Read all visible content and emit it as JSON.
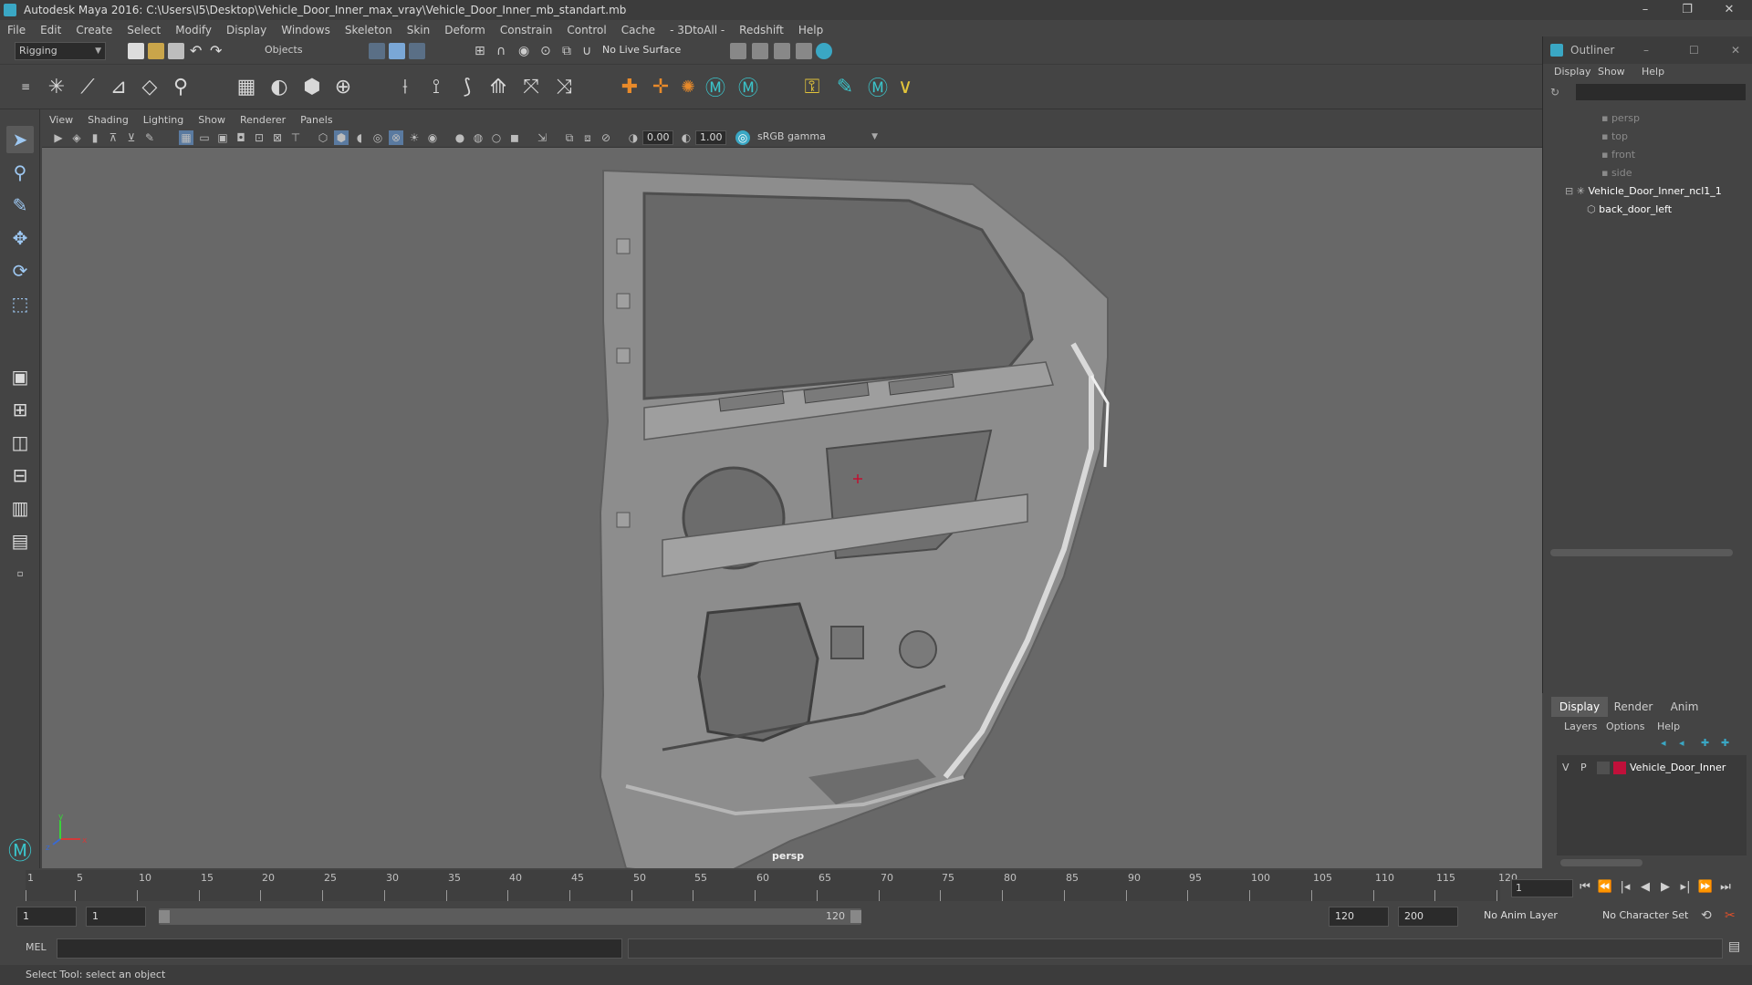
{
  "window": {
    "title": "Autodesk Maya 2016: C:\\Users\\I5\\Desktop\\Vehicle_Door_Inner_max_vray\\Vehicle_Door_Inner_mb_standart.mb",
    "minimize": "–",
    "restore": "❐",
    "close": "✕"
  },
  "menu": [
    "File",
    "Edit",
    "Create",
    "Select",
    "Modify",
    "Display",
    "Windows",
    "Skeleton",
    "Skin",
    "Deform",
    "Constrain",
    "Control",
    "Cache",
    "- 3DtoAll -",
    "Redshift",
    "Help"
  ],
  "statusline": {
    "menuset": "Rigging",
    "selection_mode": "Objects",
    "live_surface": "No Live Surface"
  },
  "viewport": {
    "menu": [
      "View",
      "Shading",
      "Lighting",
      "Show",
      "Renderer",
      "Panels"
    ],
    "exposure": "0.00",
    "gamma": "1.00",
    "color_space": "sRGB gamma",
    "camera_label": "persp",
    "axis_labels": {
      "x": "x",
      "y": "y",
      "z": "z"
    }
  },
  "outliner": {
    "title": "Outliner",
    "menu": [
      "Display",
      "Show",
      "Help"
    ],
    "items": [
      {
        "label": "persp",
        "type": "camera"
      },
      {
        "label": "top",
        "type": "camera"
      },
      {
        "label": "front",
        "type": "camera"
      },
      {
        "label": "side",
        "type": "camera"
      },
      {
        "label": "Vehicle_Door_Inner_ncl1_1",
        "type": "group"
      },
      {
        "label": "back_door_left",
        "type": "mesh"
      }
    ]
  },
  "layers": {
    "tabs": [
      "Display",
      "Render",
      "Anim"
    ],
    "menu": [
      "Layers",
      "Options",
      "Help"
    ],
    "rows": [
      {
        "v": "V",
        "p": "P",
        "color": "#c0103a",
        "name": "Vehicle_Door_Inner"
      }
    ]
  },
  "timeline": {
    "ticks": [
      "1",
      "5",
      "10",
      "15",
      "20",
      "25",
      "30",
      "35",
      "40",
      "45",
      "50",
      "55",
      "60",
      "65",
      "70",
      "75",
      "80",
      "85",
      "90",
      "95",
      "100",
      "105",
      "110",
      "115",
      "120"
    ],
    "current_frame": "1"
  },
  "range": {
    "start_frame": "1",
    "playback_start": "1",
    "slider_start": "1",
    "slider_end": "120",
    "playback_end": "120",
    "end_frame": "200",
    "anim_layer": "No Anim Layer",
    "character_set": "No Character Set"
  },
  "command": {
    "language": "MEL"
  },
  "help_line": "Select Tool: select an object"
}
